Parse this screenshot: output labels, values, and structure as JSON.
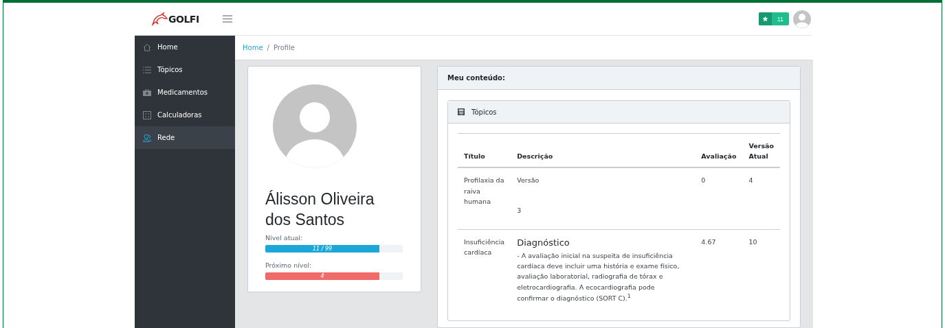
{
  "header": {
    "logo": "GOLFI",
    "badge_count": "11"
  },
  "sidebar": {
    "items": [
      {
        "label": "Home",
        "kind": "home",
        "selected": false
      },
      {
        "label": "Tópicos",
        "kind": "list",
        "selected": false
      },
      {
        "label": "Medicamentos",
        "kind": "kit",
        "selected": false
      },
      {
        "label": "Calculadoras",
        "kind": "calc",
        "selected": false
      },
      {
        "label": "Rede",
        "kind": "people",
        "selected": true
      }
    ]
  },
  "breadcrumb": [
    {
      "label": "Home",
      "kind": "link"
    },
    {
      "label": "/",
      "kind": "separator"
    },
    {
      "label": "Profile",
      "kind": "current"
    }
  ],
  "profile": {
    "name": "Álisson Oliveira dos Santos",
    "meters": [
      {
        "label": "Nível atual:",
        "reading": "11 / 99",
        "level": 0.83,
        "color": "#1ba8d8"
      },
      {
        "label": "Próximo nível:",
        "reading": "4",
        "level": 0.83,
        "color": "#f06a6a"
      }
    ]
  },
  "content": {
    "title": "Meu conteúdo:",
    "panel_title": "Tópicos",
    "table": {
      "columns": [
        "Título",
        "Descrição",
        "Avaliação",
        "Versão Atual"
      ],
      "rows": [
        {
          "title": "Profilaxia da raiva humana",
          "description": [
            {
              "kind": "text",
              "text": "Versão"
            },
            {
              "kind": "text",
              "text": "3"
            }
          ],
          "rating": "0",
          "version": "4"
        },
        {
          "title": "Insuficiência cardíaca",
          "description": [
            {
              "kind": "heading",
              "text": "Diagnóstico"
            },
            {
              "kind": "text",
              "text": "- A avaliação inicial na suspeita de insuficiência cardíaca deve incluir uma história e exame físico, avaliação laboratorial, radiografia de tórax e eletrocardiografia. A ecocardiografia pode confirmar o diagnóstico (SORT C).$^{1}$"
            }
          ],
          "rating": "4.67",
          "version": "10"
        }
      ]
    }
  }
}
